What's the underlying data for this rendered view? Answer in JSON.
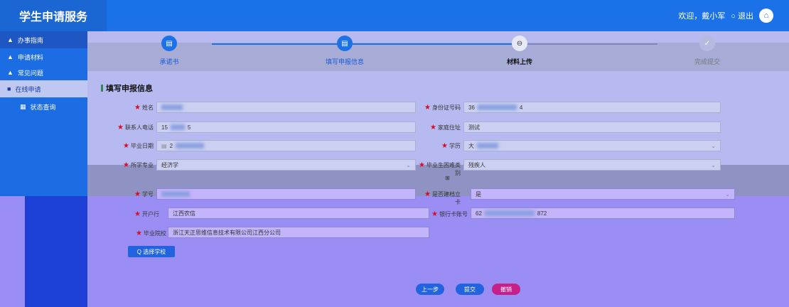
{
  "header": {
    "title": "学生申请服务",
    "welcome": "欢迎，戴小军",
    "logout": "○ 退出"
  },
  "sidebar": {
    "items": [
      {
        "label": "办事指南"
      },
      {
        "label": "申请材料"
      },
      {
        "label": "常见问题"
      },
      {
        "label": "在线申请"
      },
      {
        "label": "状态查询"
      }
    ]
  },
  "steps": [
    {
      "label": "承诺书"
    },
    {
      "label": "填写申报信息"
    },
    {
      "label": "材料上传"
    },
    {
      "label": "完成提交"
    }
  ],
  "form": {
    "title": "填写申报信息",
    "fields": {
      "name": {
        "label": "姓名",
        "value": ""
      },
      "id_number": {
        "label": "身份证号码",
        "value_prefix": "36",
        "value_suffix": "4"
      },
      "phone": {
        "label": "联系人电话",
        "value_prefix": "15",
        "value_suffix": "5"
      },
      "address": {
        "label": "家庭住址",
        "value": "测试"
      },
      "grad_date": {
        "label": "毕业日期",
        "value_prefix": "2"
      },
      "education": {
        "label": "学历",
        "value_prefix": "大"
      },
      "major": {
        "label": "所学专业",
        "value": "经济学"
      },
      "difficulty": {
        "label": "毕业生困难类别",
        "value": "残疾人"
      },
      "student_id": {
        "label": "学号",
        "value": ""
      },
      "registered": {
        "label": "是否建档立卡",
        "value": "是"
      },
      "bank": {
        "label": "开户行",
        "value": "江西农信"
      },
      "card_number": {
        "label": "银行卡账号",
        "value_prefix": "62",
        "value_suffix": "872"
      },
      "school": {
        "label": "毕业院校",
        "value": "浙江天正思维信息技术有限公司江西分公司"
      }
    },
    "select_school_btn": "Q 选择学校",
    "prev_btn": "上一步",
    "submit_btn": "提交",
    "cancel_btn": "撤销"
  },
  "colors": {
    "primary": "#1b72e8",
    "accent": "#d0102a",
    "overlay": "#9a8ef5"
  }
}
